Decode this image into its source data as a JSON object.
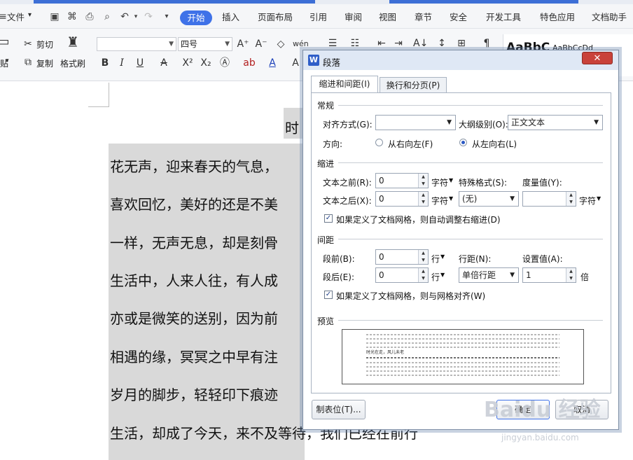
{
  "menubar": {
    "file_label": "文件",
    "tabs": [
      "开始",
      "插入",
      "页面布局",
      "引用",
      "审阅",
      "视图",
      "章节",
      "安全",
      "开发工具",
      "特色应用",
      "文档助手"
    ],
    "active_tab": "开始"
  },
  "ribbon": {
    "paste_label": "贴",
    "cut_label": "剪切",
    "copy_label": "复制",
    "format_painter_label": "格式刷",
    "font_size": "四号",
    "style_preview_large": "AaBbC",
    "style_preview_small": "AaBbCcDd"
  },
  "document": {
    "lines": [
      "时",
      "花无声，迎来春天的气息，",
      "喜欢回忆，美好的还是不美",
      "一样，无声无息，却是刻骨",
      "生活中，人来人往，有人成",
      "亦或是微笑的送别，因为前",
      "相遇的缘，冥冥之中早有注",
      "岁月的脚步，轻轻印下痕迹",
      "生活，却成了今天，来不及等待，我们已经在前行"
    ]
  },
  "dialog": {
    "title": "段落",
    "close_glyph": "✕",
    "tabs": [
      "缩进和间距(I)",
      "换行和分页(P)"
    ],
    "general": {
      "section": "常规",
      "align_label": "对齐方式(G):",
      "align_value": "",
      "outline_label": "大纲级别(O):",
      "outline_value": "正文文本",
      "direction_label": "方向:",
      "rtl_label": "从右向左(F)",
      "ltr_label": "从左向右(L)",
      "direction_selected": "ltr"
    },
    "indent": {
      "section": "缩进",
      "before_label": "文本之前(R):",
      "before_value": "0",
      "before_unit": "字符",
      "after_label": "文本之后(X):",
      "after_value": "0",
      "after_unit": "字符",
      "special_label": "特殊格式(S):",
      "special_value": "(无)",
      "measure_label": "度量值(Y):",
      "measure_value": "",
      "measure_unit": "字符",
      "grid_check_label": "如果定义了文档网格，则自动调整右缩进(D)",
      "grid_checked": true
    },
    "spacing": {
      "section": "间距",
      "before_label": "段前(B):",
      "before_value": "0",
      "before_unit": "行",
      "after_label": "段后(E):",
      "after_value": "0",
      "after_unit": "行",
      "line_label": "行距(N):",
      "line_value": "单倍行距",
      "setting_label": "设置值(A):",
      "setting_value": "1",
      "setting_unit": "倍",
      "grid_check_label": "如果定义了文档网格，则与网格对齐(W)",
      "grid_checked": true
    },
    "preview": {
      "section": "预览",
      "sample_text": "时光在走，风儿未老"
    },
    "tabs_button": "制表位(T)...",
    "ok_button": "确定",
    "cancel_button": "取消"
  },
  "watermark": {
    "text": "Baidu 经验",
    "url": "jingyan.baidu.com"
  }
}
